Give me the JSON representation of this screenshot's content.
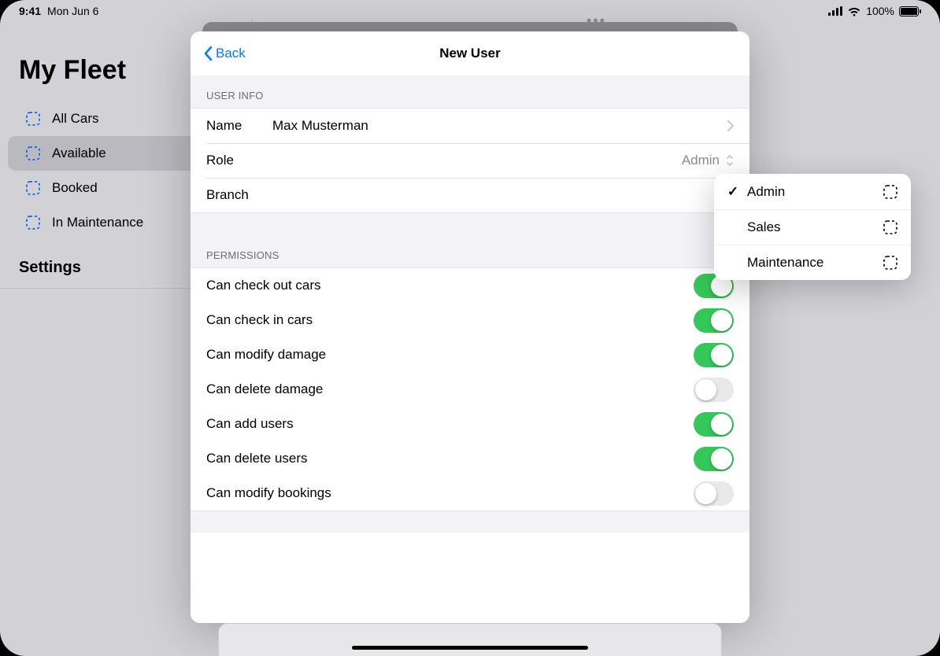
{
  "status": {
    "time": "9:41",
    "date": "Mon Jun 6",
    "battery_pct": "100%"
  },
  "sidebar": {
    "title": "My Fleet",
    "items": [
      {
        "label": "All Cars"
      },
      {
        "label": "Available"
      },
      {
        "label": "Booked"
      },
      {
        "label": "In Maintenance"
      }
    ],
    "settings_label": "Settings"
  },
  "sheet": {
    "back_label": "Back",
    "title": "New User",
    "sections": {
      "user_info_header": "USER INFO",
      "permissions_header": "PERMISSIONS"
    },
    "user_info": {
      "name_label": "Name",
      "name_value": "Max Musterman",
      "role_label": "Role",
      "role_value": "Admin",
      "branch_label": "Branch",
      "branch_value": ""
    },
    "permissions": [
      {
        "label": "Can check out cars",
        "on": true
      },
      {
        "label": "Can check in cars",
        "on": true
      },
      {
        "label": "Can modify damage",
        "on": true
      },
      {
        "label": "Can delete damage",
        "on": false
      },
      {
        "label": "Can add users",
        "on": true
      },
      {
        "label": "Can delete users",
        "on": true
      },
      {
        "label": "Can modify bookings",
        "on": false
      }
    ]
  },
  "popover": {
    "options": [
      {
        "label": "Admin",
        "selected": true
      },
      {
        "label": "Sales",
        "selected": false
      },
      {
        "label": "Maintenance",
        "selected": false
      }
    ]
  }
}
